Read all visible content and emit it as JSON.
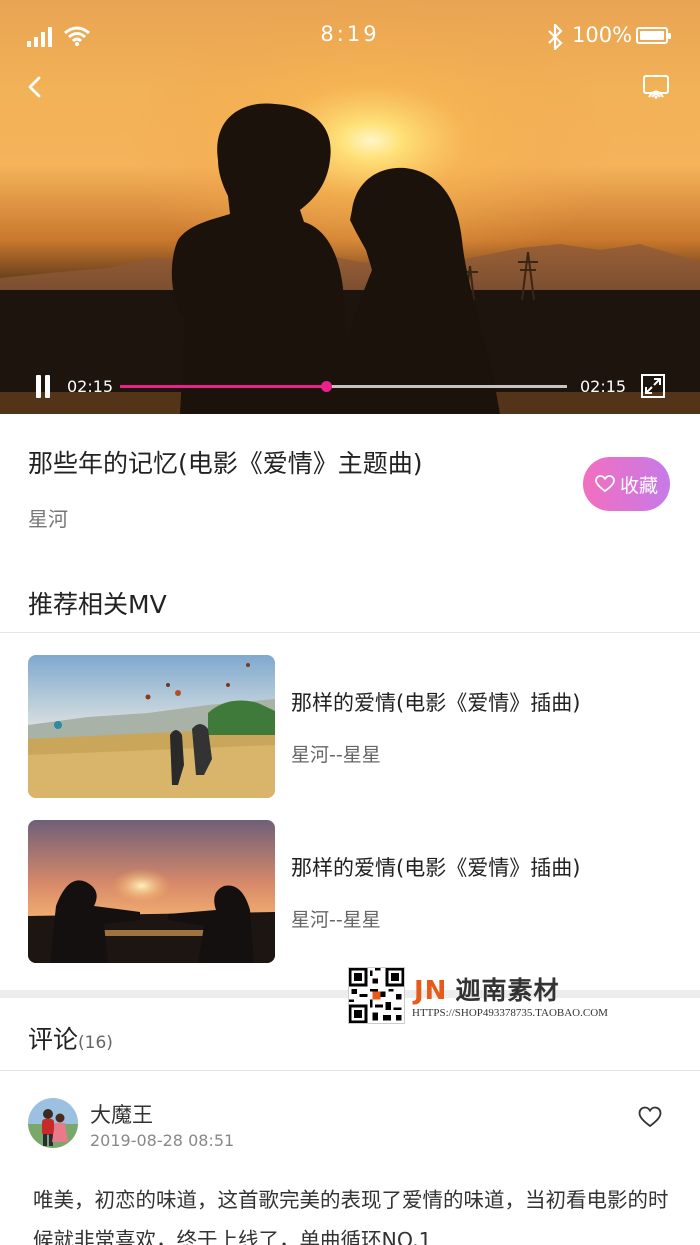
{
  "status_bar": {
    "time": "8:19",
    "battery": "100%"
  },
  "player": {
    "current_time": "02:15",
    "total_time": "02:15",
    "progress": 0.46,
    "accent_color": "#e8218b"
  },
  "song": {
    "title": "那些年的记忆(电影《爱情》主题曲)",
    "artist": "星河",
    "favorite_label": "收藏"
  },
  "related": {
    "heading": "推荐相关MV",
    "items": [
      {
        "title": "那样的爱情(电影《爱情》插曲)",
        "artist": "星河--星星",
        "thumb": "couple-field-balloons"
      },
      {
        "title": "那样的爱情(电影《爱情》插曲)",
        "artist": "星河--星星",
        "thumb": "couple-sunset-silhouette"
      }
    ]
  },
  "comments": {
    "heading": "评论",
    "count": "(16)",
    "items": [
      {
        "user": "大魔王",
        "time": "2019-08-28  08:51",
        "text": "唯美，初恋的味道，这首歌完美的表现了爱情的味道，当初看电影的时候就非常喜欢，终于上线了，单曲循环NO.1"
      }
    ]
  },
  "watermark": {
    "brand_mark": "JN",
    "brand_text": "迦南素材",
    "url": "HTTPS://SHOP493378735.TAOBAO.COM"
  }
}
